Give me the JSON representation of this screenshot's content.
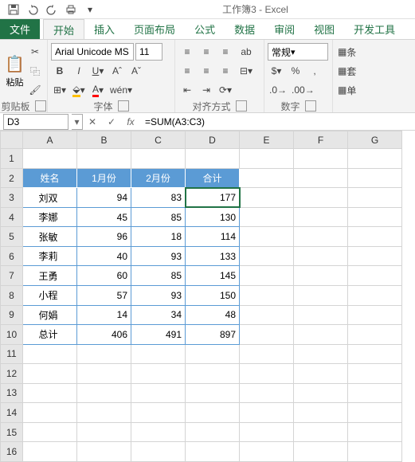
{
  "app": {
    "title": "工作簿3 - Excel"
  },
  "tabs": {
    "file": "文件",
    "home": "开始",
    "insert": "插入",
    "layout": "页面布局",
    "formulas": "公式",
    "data": "数据",
    "review": "审阅",
    "view": "视图",
    "dev": "开发工具"
  },
  "ribbon": {
    "clipboard": {
      "label": "剪贴板",
      "paste": "粘贴"
    },
    "font": {
      "label": "字体",
      "name": "Arial Unicode MS",
      "size": "11"
    },
    "align": {
      "label": "对齐方式",
      "wrap": "ab"
    },
    "number": {
      "label": "数字",
      "format": "常规"
    },
    "styles": {
      "cond": "条",
      "table": "套",
      "cell": "单"
    }
  },
  "namebox": "D3",
  "formula": "=SUM(A3:C3)",
  "cols": [
    "A",
    "B",
    "C",
    "D",
    "E",
    "F",
    "G"
  ],
  "rows": [
    "1",
    "2",
    "3",
    "4",
    "5",
    "6",
    "7",
    "8",
    "9",
    "10",
    "11",
    "12",
    "13",
    "14",
    "15",
    "16"
  ],
  "chart_data": {
    "type": "table",
    "headers": [
      "姓名",
      "1月份",
      "2月份",
      "合计"
    ],
    "data": [
      [
        "刘双",
        94,
        83,
        177
      ],
      [
        "李娜",
        45,
        85,
        130
      ],
      [
        "张敏",
        96,
        18,
        114
      ],
      [
        "李莉",
        40,
        93,
        133
      ],
      [
        "王勇",
        60,
        85,
        145
      ],
      [
        "小程",
        57,
        93,
        150
      ],
      [
        "何娟",
        14,
        34,
        48
      ],
      [
        "总计",
        406,
        491,
        897
      ]
    ]
  }
}
